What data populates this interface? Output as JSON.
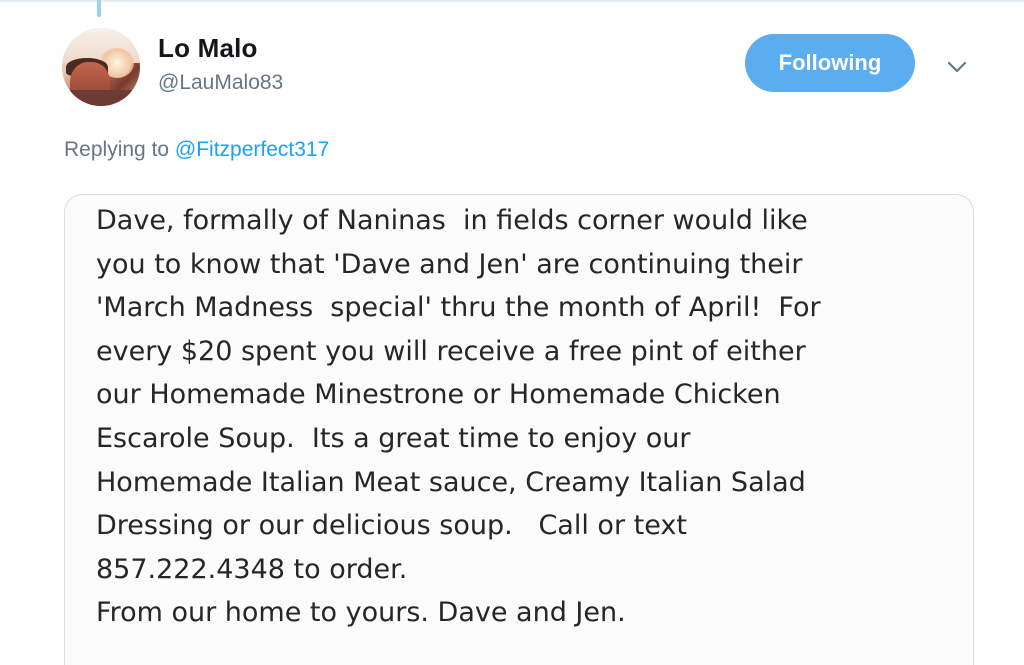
{
  "tweet": {
    "author_name": "Lo Malo",
    "author_handle": "@LauMalo83",
    "follow_button_label": "Following",
    "reply_prefix": "Replying to ",
    "reply_mention": "@Fitzperfect317",
    "image_text_lines": [
      "Dave, formally of Naninas  in fields corner would like",
      "you to know that 'Dave and Jen' are continuing their",
      "'March Madness  special' thru the month of April!  For",
      "every $20 spent you will receive a free pint of either",
      "our Homemade Minestrone or Homemade Chicken",
      "Escarole Soup.  Its a great time to enjoy our",
      "Homemade Italian Meat sauce, Creamy Italian Salad",
      "Dressing or our delicious soup.   Call or text",
      "857.222.4348 to order.",
      "From our home to yours. Dave and Jen."
    ]
  },
  "icons": {
    "menu_caret": "chevron-down-icon",
    "avatar": "profile-photo"
  },
  "colors": {
    "follow_button_bg": "#5aaef0",
    "mention_link": "#1da1f2",
    "secondary_text": "#657786",
    "thread_line": "#9ad2f5"
  }
}
